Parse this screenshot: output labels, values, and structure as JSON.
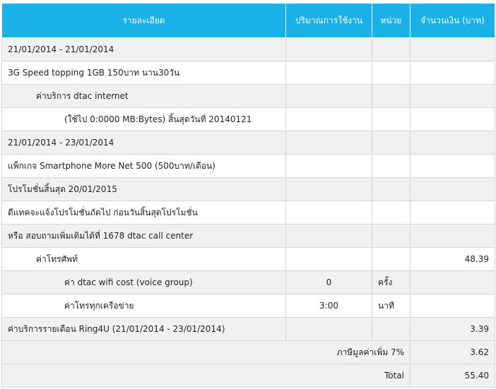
{
  "header": {
    "description": "รายละเอียด",
    "usage": "ปริมาณการใช้งาน",
    "unit": "หน่วย",
    "amount": "จำนวนเงิน (บาท)"
  },
  "rows": [
    {
      "text": "21/01/2014 - 21/01/2014",
      "usage": "",
      "unit": "",
      "amount": "",
      "indent": 0
    },
    {
      "text": "3G Speed topping 1GB 150บาท นาน30วัน",
      "usage": "",
      "unit": "",
      "amount": "",
      "indent": 0
    },
    {
      "text": "ค่าบริการ dtac internet",
      "usage": "",
      "unit": "",
      "amount": "",
      "indent": 1
    },
    {
      "text": "(ใช้ไป 0:0000 MB:Bytes) สิ้นสุดวันที่ 20140121",
      "usage": "",
      "unit": "",
      "amount": "",
      "indent": 2
    },
    {
      "text": "21/01/2014 - 23/01/2014",
      "usage": "",
      "unit": "",
      "amount": "",
      "indent": 0
    },
    {
      "text": "แพ็กเกจ Smartphone More Net 500 (500บาท/เดือน)",
      "usage": "",
      "unit": "",
      "amount": "",
      "indent": 0
    },
    {
      "text": "โปรโมชั่นสิ้นสุด 20/01/2015",
      "usage": "",
      "unit": "",
      "amount": "",
      "indent": 0
    },
    {
      "text": "ดีแทคจะแจ้งโปรโมชั่นถัดไป ก่อนวันสิ้นสุดโปรโมชั่น",
      "usage": "",
      "unit": "",
      "amount": "",
      "indent": 0
    },
    {
      "text": "หรือ สอบถามเพิ่มเติมได้ที่ 1678 dtac call center",
      "usage": "",
      "unit": "",
      "amount": "",
      "indent": 0
    },
    {
      "text": "ค่าโทรศัพท์",
      "usage": "",
      "unit": "",
      "amount": "48.39",
      "indent": 1
    },
    {
      "text": "ค่า dtac wifi cost (voice group)",
      "usage": "0",
      "unit": "ครั้ง",
      "amount": "",
      "indent": 2
    },
    {
      "text": "ค่าโทรทุกเครือข่าย",
      "usage": "3:00",
      "unit": "นาที",
      "amount": "",
      "indent": 2
    },
    {
      "text": "ค่าบริการรายเดือน Ring4U  (21/01/2014 - 23/01/2014)",
      "usage": "",
      "unit": "",
      "amount": "3.39",
      "indent": 0
    }
  ],
  "footer": {
    "vat_label": "ภาษีมูลค่าเพิ่ม 7%",
    "vat_amount": "3.62",
    "total_label": "Total",
    "total_amount": "55.40"
  }
}
